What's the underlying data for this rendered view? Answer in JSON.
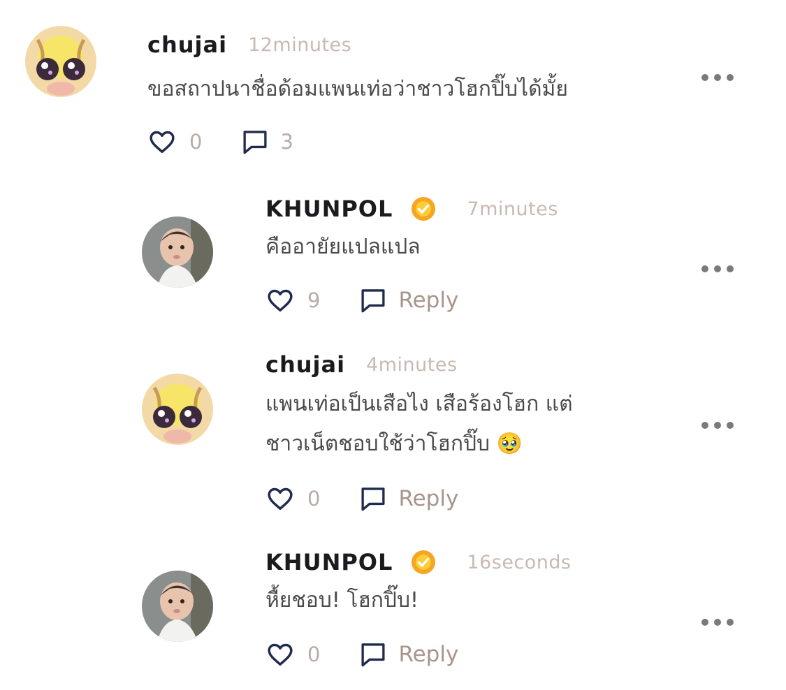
{
  "comments": [
    {
      "username": "chujai",
      "time": "12minutes",
      "verified": false,
      "lines": [
        "ขอสถาปนาชื่อด้อมแพนเท่อว่าชาวโฮกปิ๊บได้มั้ย"
      ],
      "likes": "0",
      "replies": "3",
      "avatar_icon": "cat-avatar"
    },
    {
      "username": "KHUNPOL",
      "time": "7minutes",
      "verified": true,
      "lines": [
        "คืออายัยแปลแปล"
      ],
      "likes": "9",
      "reply_label": "Reply",
      "avatar_icon": "baby-photo-avatar"
    },
    {
      "username": "chujai",
      "time": "4minutes",
      "verified": false,
      "lines": [
        "แพนเท่อเป็นเสือไง เสือร้องโฮก แต่",
        "ชาวเน็ตชอบใช้ว่าโฮกปิ๊บ 🥹"
      ],
      "likes": "0",
      "reply_label": "Reply",
      "avatar_icon": "cat-avatar"
    },
    {
      "username": "KHUNPOL",
      "time": "16seconds",
      "verified": true,
      "lines": [
        "หื้ยชอบ! โฮกปิ๊บ!"
      ],
      "likes": "0",
      "reply_label": "Reply",
      "avatar_icon": "baby-photo-avatar"
    }
  ],
  "icons": {
    "like": "heart-outline-icon",
    "comment": "speech-bubble-icon",
    "more": "more-horizontal-icon",
    "verified": "verified-badge-icon"
  },
  "colors": {
    "username": "#1b1b1f",
    "time": "#c9b9b2",
    "body_text": "#4a4a4a",
    "icon_navy": "#1f2a4d",
    "verified_orange": "#f5a623"
  }
}
